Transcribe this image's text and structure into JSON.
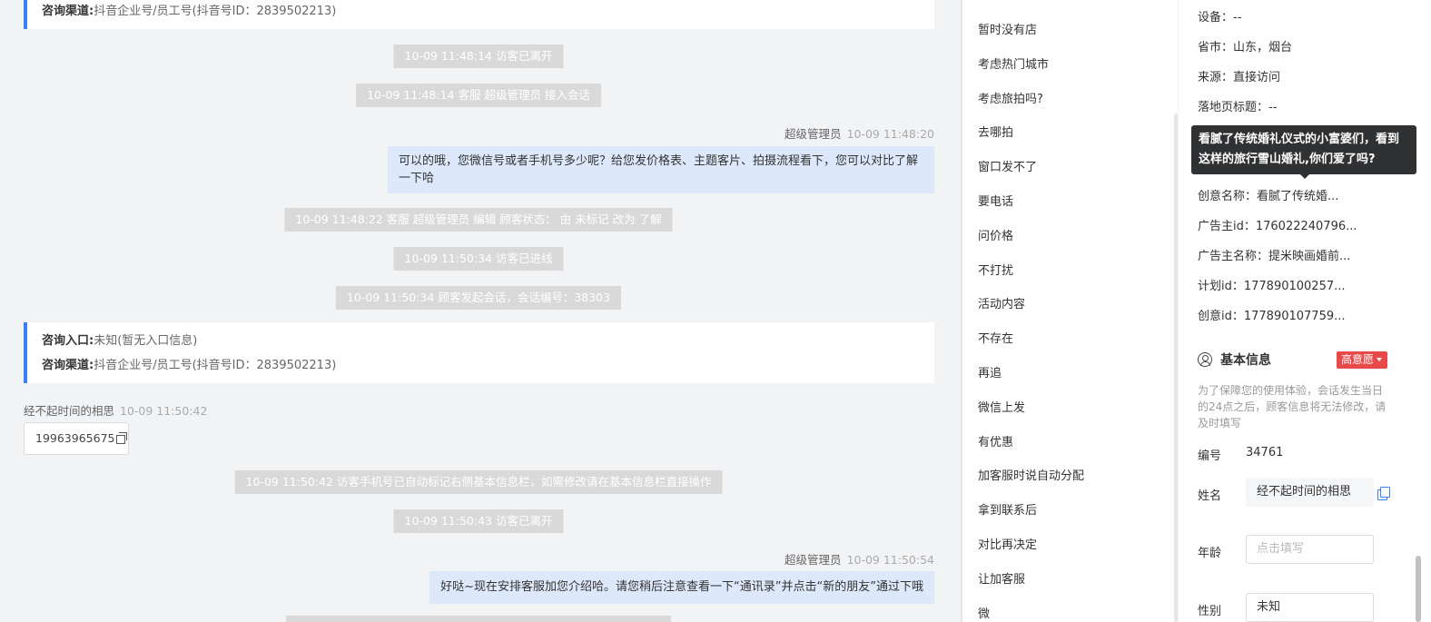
{
  "chat": {
    "card1": {
      "channel_label": "咨询渠道:",
      "channel_value": "抖音企业号/员工号(抖音号ID：2839502213)"
    },
    "sys1": "10-09 11:48:14 访客已离开",
    "sys2": "10-09 11:48:14 客服 超级管理员 接入会话",
    "msg1": {
      "sender": "超级管理员",
      "time": "10-09 11:48:20",
      "text": "可以的哦，您微信号或者手机号多少呢？给您发价格表、主题客片、拍摄流程看下，您可以对比了解一下哈"
    },
    "sys3": "10-09 11:48:22 客服 超级管理员 编辑 顾客状态： 由 未标记 改为 了解",
    "sys4": "10-09 11:50:34 访客已进线",
    "sys5": "10-09 11:50:34 顾客发起会话，会话编号：38303",
    "card2": {
      "entry_label": "咨询入口:",
      "entry_value": "未知(暂无入口信息)",
      "channel_label": "咨询渠道:",
      "channel_value": "抖音企业号/员工号(抖音号ID：2839502213)"
    },
    "visitor": {
      "name": "经不起时间的相思",
      "time": "10-09 11:50:42",
      "phone": "19963965675"
    },
    "sys6": "10-09 11:50:42 访客手机号已自动标记右侧基本信息栏，如需修改请在基本信息栏直接操作",
    "sys7": "10-09 11:50:43 访客已离开",
    "msg2": {
      "sender": "超级管理员",
      "time": "10-09 11:50:54",
      "text": "好哒~现在安排客服加您介绍哈。请您稍后注意查看一下“通讯录”并点击“新的朋友”通过下哦"
    }
  },
  "quick_replies": [
    "暂时没有店",
    "考虑热门城市",
    "考虑旅拍吗?",
    "去哪拍",
    "窗口发不了",
    "要电话",
    "问价格",
    "不打扰",
    "活动内容",
    "不存在",
    "再追",
    "微信上发",
    "有优惠",
    "加客服时说自动分配",
    "拿到联系后",
    "对比再决定",
    "让加客服",
    "微"
  ],
  "panel": {
    "device": "设备：--",
    "province": "省市：山东，烟台",
    "source": "来源：直接访问",
    "landing": "落地页标题：--",
    "tooltip": "看腻了传统婚礼仪式的小富婆们，看到这样的旅行雪山婚礼,你们爱了吗?",
    "creative_name": "创意名称：看腻了传统婚...",
    "advertiser_id": "广告主id：176022240796...",
    "advertiser_name": "广告主名称：提米映画婚前...",
    "plan_id": "计划id：177890100257...",
    "creative_id": "创意id：177890107759...",
    "section_title": "基本信息",
    "intent_badge": "高意愿",
    "hint": "为了保障您的使用体验，会话发生当日的24点之后，顾客信息将无法修改，请及时填写",
    "fields": {
      "number_label": "编号",
      "number_value": "34761",
      "name_label": "姓名",
      "name_value": "经不起时间的相思",
      "age_label": "年龄",
      "age_placeholder": "点击填写",
      "gender_label": "性别",
      "gender_value": "未知"
    }
  },
  "colors": {
    "accent": "#3d7ff5",
    "bubble": "#dde8fb",
    "badge": "#e84a4a",
    "system": "#d9d9d9"
  }
}
